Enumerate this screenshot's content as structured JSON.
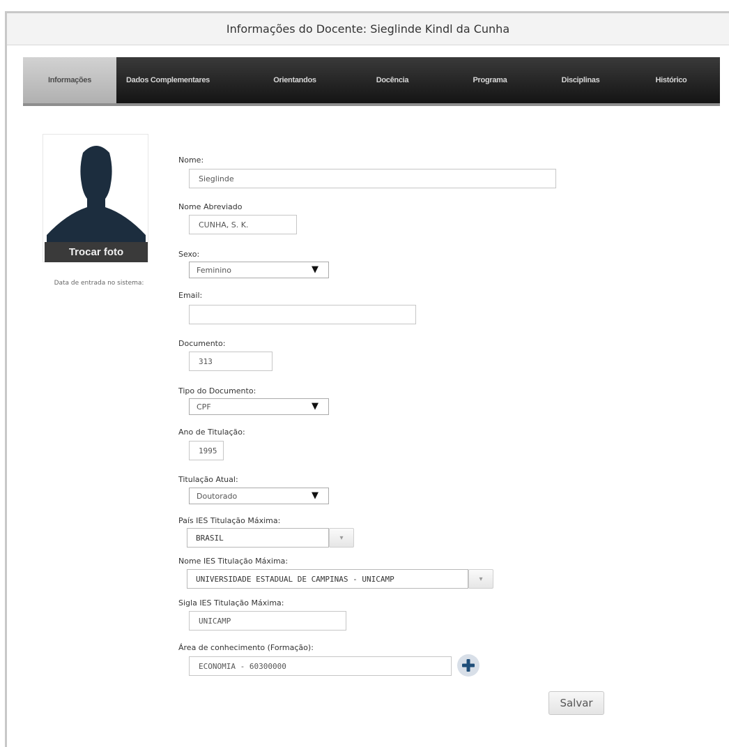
{
  "window": {
    "title": "Informações do Docente: Sieglinde Kindl da Cunha"
  },
  "tabs": [
    {
      "label": "Informações",
      "active": true
    },
    {
      "label": "Dados Complementares"
    },
    {
      "label": "Orientandos"
    },
    {
      "label": "Docência"
    },
    {
      "label": "Programa"
    },
    {
      "label": "Disciplinas"
    },
    {
      "label": "Histórico"
    }
  ],
  "profile": {
    "change_photo_label": "Trocar foto",
    "entry_date_label": "Data de entrada no sistema:"
  },
  "form": {
    "nome": {
      "label": "Nome:",
      "value": "Sieglinde"
    },
    "nome_abreviado": {
      "label": "Nome Abreviado",
      "value": "CUNHA, S. K."
    },
    "sexo": {
      "label": "Sexo:",
      "value": "Feminino"
    },
    "email": {
      "label": "Email:",
      "value": ""
    },
    "documento": {
      "label": "Documento:",
      "value": "313"
    },
    "tipo_documento": {
      "label": "Tipo do Documento:",
      "value": "CPF"
    },
    "ano_titulacao": {
      "label": "Ano de Titulação:",
      "value": "1995"
    },
    "titulacao_atual": {
      "label": "Titulação Atual:",
      "value": "Doutorado"
    },
    "pais_ies": {
      "label": "País IES Titulação Máxima:",
      "value": "BRASIL"
    },
    "nome_ies": {
      "label": "Nome IES Titulação Máxima:",
      "value": "UNIVERSIDADE ESTADUAL DE CAMPINAS - UNICAMP"
    },
    "sigla_ies": {
      "label": "Sigla IES Titulação Máxima:",
      "value": "UNICAMP"
    },
    "area_conhecimento": {
      "label": "Área de conhecimento (Formação):",
      "value": "ECONOMIA - 60300000"
    }
  },
  "actions": {
    "save_label": "Salvar"
  },
  "icons": {
    "dropdown_arrow": "▼",
    "combo_arrow": "▾",
    "add": "plus-icon"
  },
  "colors": {
    "navbar": "#1e1e1e",
    "accent_add": "#1f4e79",
    "avatar": "#1c2d3e"
  }
}
